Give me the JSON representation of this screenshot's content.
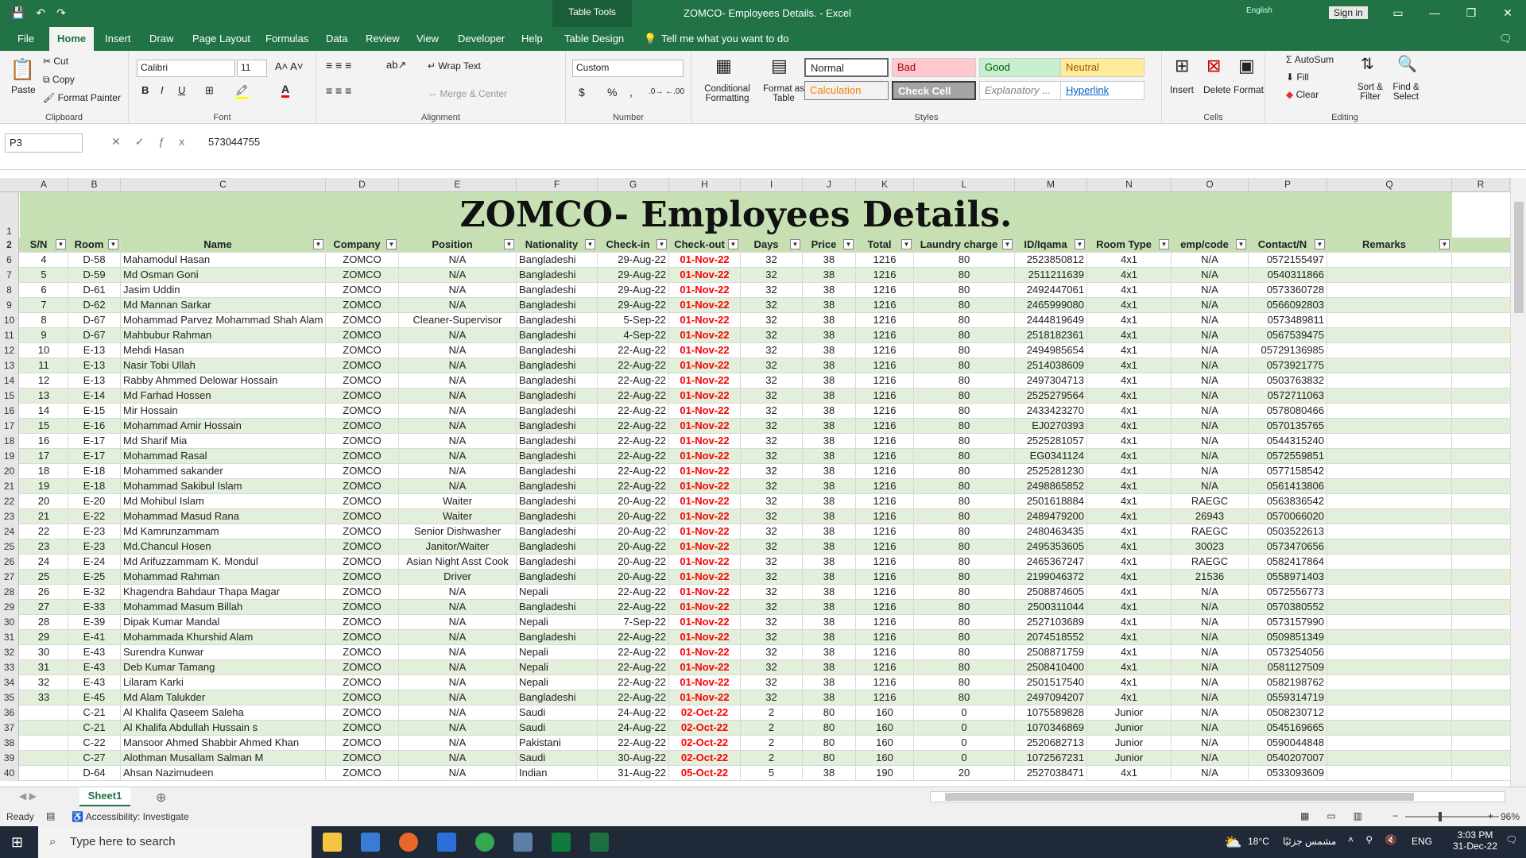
{
  "window": {
    "title": "ZOMCO- Employees Details.  -  Excel",
    "table_tools": "Table Tools",
    "language_hint": "English",
    "sign_in": "Sign in"
  },
  "menu": {
    "tabs": [
      "File",
      "Home",
      "Insert",
      "Draw",
      "Page Layout",
      "Formulas",
      "Data",
      "Review",
      "View",
      "Developer",
      "Help",
      "Table Design"
    ],
    "active": "Home",
    "tell_me": "Tell me what you want to do"
  },
  "ribbon": {
    "clipboard": {
      "label": "Clipboard",
      "paste": "Paste",
      "cut": "Cut",
      "copy": "Copy",
      "format_painter": "Format Painter"
    },
    "font": {
      "label": "Font",
      "family": "Calibri",
      "size": "11",
      "bold": "B",
      "italic": "I",
      "underline": "U"
    },
    "alignment": {
      "label": "Alignment",
      "wrap": "Wrap Text",
      "merge": "Merge & Center"
    },
    "number": {
      "label": "Number",
      "format": "Custom",
      "currency": "$",
      "percent": "%",
      "comma": ","
    },
    "styles": {
      "label": "Styles",
      "conditional": "Conditional Formatting",
      "format_table": "Format as Table",
      "normal": "Normal",
      "bad": "Bad",
      "good": "Good",
      "neutral": "Neutral",
      "calculation": "Calculation",
      "check_cell": "Check Cell",
      "explanatory": "Explanatory ...",
      "hyperlink": "Hyperlink"
    },
    "cells": {
      "label": "Cells",
      "insert": "Insert",
      "delete": "Delete",
      "format": "Format"
    },
    "editing": {
      "label": "Editing",
      "autosum": "AutoSum",
      "fill": "Fill",
      "clear": "Clear",
      "sort": "Sort & Filter",
      "find": "Find & Select"
    }
  },
  "formula_bar": {
    "name_box": "P3",
    "value": "573044755"
  },
  "columns": [
    "A",
    "B",
    "C",
    "D",
    "E",
    "F",
    "G",
    "H",
    "I",
    "J",
    "K",
    "L",
    "M",
    "N",
    "O",
    "P",
    "Q",
    "R"
  ],
  "sheet_title": "ZOMCO- Employees Details.",
  "headers": [
    "S/N",
    "Room",
    "Name",
    "Company",
    "Position",
    "Nationality",
    "Check-in",
    "Check-out",
    "Days",
    "Price",
    "Total",
    "Laundry charge",
    "ID/Iqama",
    "Room Type",
    "emp/code",
    "Contact/N",
    "Remarks"
  ],
  "rows": [
    [
      "6",
      "4",
      "D-58",
      "Mahamodul Hasan",
      "ZOMCO",
      "N/A",
      "Bangladeshi",
      "29-Aug-22",
      "01-Nov-22",
      "32",
      "38",
      "1216",
      "80",
      "2523850812",
      "4x1",
      "N/A",
      "0572155497",
      ""
    ],
    [
      "7",
      "5",
      "D-59",
      "Md Osman Goni",
      "ZOMCO",
      "N/A",
      "Bangladeshi",
      "29-Aug-22",
      "01-Nov-22",
      "32",
      "38",
      "1216",
      "80",
      "2511211639",
      "4x1",
      "N/A",
      "0540311866",
      ""
    ],
    [
      "8",
      "6",
      "D-61",
      "Jasim Uddin",
      "ZOMCO",
      "N/A",
      "Bangladeshi",
      "29-Aug-22",
      "01-Nov-22",
      "32",
      "38",
      "1216",
      "80",
      "2492447061",
      "4x1",
      "N/A",
      "0573360728",
      ""
    ],
    [
      "9",
      "7",
      "D-62",
      "Md Mannan Sarkar",
      "ZOMCO",
      "N/A",
      "Bangladeshi",
      "29-Aug-22",
      "01-Nov-22",
      "32",
      "38",
      "1216",
      "80",
      "2465999080",
      "4x1",
      "N/A",
      "0566092803",
      ""
    ],
    [
      "10",
      "8",
      "D-67",
      "Mohammad Parvez Mohammad Shah Alam",
      "ZOMCO",
      "Cleaner-Supervisor",
      "Bangladeshi",
      "5-Sep-22",
      "01-Nov-22",
      "32",
      "38",
      "1216",
      "80",
      "2444819649",
      "4x1",
      "N/A",
      "0573489811",
      ""
    ],
    [
      "11",
      "9",
      "D-67",
      "Mahbubur Rahman",
      "ZOMCO",
      "N/A",
      "Bangladeshi",
      "4-Sep-22",
      "01-Nov-22",
      "32",
      "38",
      "1216",
      "80",
      "2518182361",
      "4x1",
      "N/A",
      "0567539475",
      ""
    ],
    [
      "12",
      "10",
      "E-13",
      "Mehdi Hasan",
      "ZOMCO",
      "N/A",
      "Bangladeshi",
      "22-Aug-22",
      "01-Nov-22",
      "32",
      "38",
      "1216",
      "80",
      "2494985654",
      "4x1",
      "N/A",
      "05729136985",
      ""
    ],
    [
      "13",
      "11",
      "E-13",
      "Nasir Tobi Ullah",
      "ZOMCO",
      "N/A",
      "Bangladeshi",
      "22-Aug-22",
      "01-Nov-22",
      "32",
      "38",
      "1216",
      "80",
      "2514038609",
      "4x1",
      "N/A",
      "0573921775",
      ""
    ],
    [
      "14",
      "12",
      "E-13",
      "Rabby Ahmmed Delowar Hossain",
      "ZOMCO",
      "N/A",
      "Bangladeshi",
      "22-Aug-22",
      "01-Nov-22",
      "32",
      "38",
      "1216",
      "80",
      "2497304713",
      "4x1",
      "N/A",
      "0503763832",
      ""
    ],
    [
      "15",
      "13",
      "E-14",
      "Md Farhad Hossen",
      "ZOMCO",
      "N/A",
      "Bangladeshi",
      "22-Aug-22",
      "01-Nov-22",
      "32",
      "38",
      "1216",
      "80",
      "2525279564",
      "4x1",
      "N/A",
      "0572711063",
      ""
    ],
    [
      "16",
      "14",
      "E-15",
      "Mir Hossain",
      "ZOMCO",
      "N/A",
      "Bangladeshi",
      "22-Aug-22",
      "01-Nov-22",
      "32",
      "38",
      "1216",
      "80",
      "2433423270",
      "4x1",
      "N/A",
      "0578080466",
      ""
    ],
    [
      "17",
      "15",
      "E-16",
      "Mohammad Amir Hossain",
      "ZOMCO",
      "N/A",
      "Bangladeshi",
      "22-Aug-22",
      "01-Nov-22",
      "32",
      "38",
      "1216",
      "80",
      "EJ0270393",
      "4x1",
      "N/A",
      "0570135765",
      ""
    ],
    [
      "18",
      "16",
      "E-17",
      "Md Sharif Mia",
      "ZOMCO",
      "N/A",
      "Bangladeshi",
      "22-Aug-22",
      "01-Nov-22",
      "32",
      "38",
      "1216",
      "80",
      "2525281057",
      "4x1",
      "N/A",
      "0544315240",
      ""
    ],
    [
      "19",
      "17",
      "E-17",
      "Mohammad Rasal",
      "ZOMCO",
      "N/A",
      "Bangladeshi",
      "22-Aug-22",
      "01-Nov-22",
      "32",
      "38",
      "1216",
      "80",
      "EG0341124",
      "4x1",
      "N/A",
      "0572559851",
      ""
    ],
    [
      "20",
      "18",
      "E-18",
      "Mohammed sakander",
      "ZOMCO",
      "N/A",
      "Bangladeshi",
      "22-Aug-22",
      "01-Nov-22",
      "32",
      "38",
      "1216",
      "80",
      "2525281230",
      "4x1",
      "N/A",
      "0577158542",
      ""
    ],
    [
      "21",
      "19",
      "E-18",
      "Mohammad Sakibul Islam",
      "ZOMCO",
      "N/A",
      "Bangladeshi",
      "22-Aug-22",
      "01-Nov-22",
      "32",
      "38",
      "1216",
      "80",
      "2498865852",
      "4x1",
      "N/A",
      "0561413806",
      ""
    ],
    [
      "22",
      "20",
      "E-20",
      "Md Mohibul Islam",
      "ZOMCO",
      "Waiter",
      "Bangladeshi",
      "20-Aug-22",
      "01-Nov-22",
      "32",
      "38",
      "1216",
      "80",
      "2501618884",
      "4x1",
      "RAEGC",
      "0563836542",
      ""
    ],
    [
      "23",
      "21",
      "E-22",
      "Mohammad Masud Rana",
      "ZOMCO",
      "Waiter",
      "Bangladeshi",
      "20-Aug-22",
      "01-Nov-22",
      "32",
      "38",
      "1216",
      "80",
      "2489479200",
      "4x1",
      "26943",
      "0570066020",
      ""
    ],
    [
      "24",
      "22",
      "E-23",
      "Md Kamrunzammam",
      "ZOMCO",
      "Senior Dishwasher",
      "Bangladeshi",
      "20-Aug-22",
      "01-Nov-22",
      "32",
      "38",
      "1216",
      "80",
      "2480463435",
      "4x1",
      "RAEGC",
      "0503522613",
      ""
    ],
    [
      "25",
      "23",
      "E-23",
      "Md.Chancul Hosen",
      "ZOMCO",
      "Janitor/Waiter",
      "Bangladeshi",
      "20-Aug-22",
      "01-Nov-22",
      "32",
      "38",
      "1216",
      "80",
      "2495353605",
      "4x1",
      "30023",
      "0573470656",
      ""
    ],
    [
      "26",
      "24",
      "E-24",
      "Md Arifuzzammam K. Mondul",
      "ZOMCO",
      "Asian Night Asst Cook",
      "Bangladeshi",
      "20-Aug-22",
      "01-Nov-22",
      "32",
      "38",
      "1216",
      "80",
      "2465367247",
      "4x1",
      "RAEGC",
      "0582417864",
      ""
    ],
    [
      "27",
      "25",
      "E-25",
      "Mohammad Rahman",
      "ZOMCO",
      "Driver",
      "Bangladeshi",
      "20-Aug-22",
      "01-Nov-22",
      "32",
      "38",
      "1216",
      "80",
      "2199046372",
      "4x1",
      "21536",
      "0558971403",
      ""
    ],
    [
      "28",
      "26",
      "E-32",
      "Khagendra Bahdaur Thapa Magar",
      "ZOMCO",
      "N/A",
      "Nepali",
      "22-Aug-22",
      "01-Nov-22",
      "32",
      "38",
      "1216",
      "80",
      "2508874605",
      "4x1",
      "N/A",
      "0572556773",
      ""
    ],
    [
      "29",
      "27",
      "E-33",
      "Mohammad Masum Billah",
      "ZOMCO",
      "N/A",
      "Bangladeshi",
      "22-Aug-22",
      "01-Nov-22",
      "32",
      "38",
      "1216",
      "80",
      "2500311044",
      "4x1",
      "N/A",
      "0570380552",
      ""
    ],
    [
      "30",
      "28",
      "E-39",
      "Dipak Kumar Mandal",
      "ZOMCO",
      "N/A",
      "Nepali",
      "7-Sep-22",
      "01-Nov-22",
      "32",
      "38",
      "1216",
      "80",
      "2527103689",
      "4x1",
      "N/A",
      "0573157990",
      ""
    ],
    [
      "31",
      "29",
      "E-41",
      "Mohammada Khurshid Alam",
      "ZOMCO",
      "N/A",
      "Bangladeshi",
      "22-Aug-22",
      "01-Nov-22",
      "32",
      "38",
      "1216",
      "80",
      "2074518552",
      "4x1",
      "N/A",
      "0509851349",
      ""
    ],
    [
      "32",
      "30",
      "E-43",
      "Surendra Kunwar",
      "ZOMCO",
      "N/A",
      "Nepali",
      "22-Aug-22",
      "01-Nov-22",
      "32",
      "38",
      "1216",
      "80",
      "2508871759",
      "4x1",
      "N/A",
      "0573254056",
      ""
    ],
    [
      "33",
      "31",
      "E-43",
      "Deb Kumar Tamang",
      "ZOMCO",
      "N/A",
      "Nepali",
      "22-Aug-22",
      "01-Nov-22",
      "32",
      "38",
      "1216",
      "80",
      "2508410400",
      "4x1",
      "N/A",
      "0581127509",
      ""
    ],
    [
      "34",
      "32",
      "E-43",
      "Lilaram Karki",
      "ZOMCO",
      "N/A",
      "Nepali",
      "22-Aug-22",
      "01-Nov-22",
      "32",
      "38",
      "1216",
      "80",
      "2501517540",
      "4x1",
      "N/A",
      "0582198762",
      ""
    ],
    [
      "35",
      "33",
      "E-45",
      "Md Alam Talukder",
      "ZOMCO",
      "N/A",
      "Bangladeshi",
      "22-Aug-22",
      "01-Nov-22",
      "32",
      "38",
      "1216",
      "80",
      "2497094207",
      "4x1",
      "N/A",
      "0559314719",
      ""
    ],
    [
      "36",
      "",
      "C-21",
      "Al Khalifa Qaseem Saleha",
      "ZOMCO",
      "N/A",
      "Saudi",
      "24-Aug-22",
      "02-Oct-22",
      "2",
      "80",
      "160",
      "0",
      "1075589828",
      "Junior",
      "N/A",
      "0508230712",
      ""
    ],
    [
      "37",
      "",
      "C-21",
      "Al Khalifa Abdullah Hussain s",
      "ZOMCO",
      "N/A",
      "Saudi",
      "24-Aug-22",
      "02-Oct-22",
      "2",
      "80",
      "160",
      "0",
      "1070346869",
      "Junior",
      "N/A",
      "0545169665",
      ""
    ],
    [
      "38",
      "",
      "C-22",
      "Mansoor Ahmed Shabbir Ahmed Khan",
      "ZOMCO",
      "N/A",
      "Pakistani",
      "22-Aug-22",
      "02-Oct-22",
      "2",
      "80",
      "160",
      "0",
      "2520682713",
      "Junior",
      "N/A",
      "0590044848",
      ""
    ],
    [
      "39",
      "",
      "C-27",
      "Alothman Musallam Salman M",
      "ZOMCO",
      "N/A",
      "Saudi",
      "30-Aug-22",
      "02-Oct-22",
      "2",
      "80",
      "160",
      "0",
      "1072567231",
      "Junior",
      "N/A",
      "0540207007",
      ""
    ],
    [
      "40",
      "",
      "D-64",
      "Ahsan Nazimudeen",
      "ZOMCO",
      "N/A",
      "Indian",
      "31-Aug-22",
      "05-Oct-22",
      "5",
      "38",
      "190",
      "20",
      "2527038471",
      "4x1",
      "N/A",
      "0533093609",
      ""
    ]
  ],
  "sheet_tab": "Sheet1",
  "status": {
    "ready": "Ready",
    "accessibility": "Accessibility: Investigate",
    "zoom": "96%"
  },
  "taskbar": {
    "search": "Type here to search",
    "weather": "18°C",
    "weather_text": "مشمس جزئيًا",
    "lang": "ENG",
    "time": "3:03 PM",
    "date": "31-Dec-22"
  },
  "colors": {
    "excel_green": "#217346",
    "header_fill": "#c6e0b4",
    "band_fill": "#e2efda",
    "checkout_red": "#ff0000"
  }
}
